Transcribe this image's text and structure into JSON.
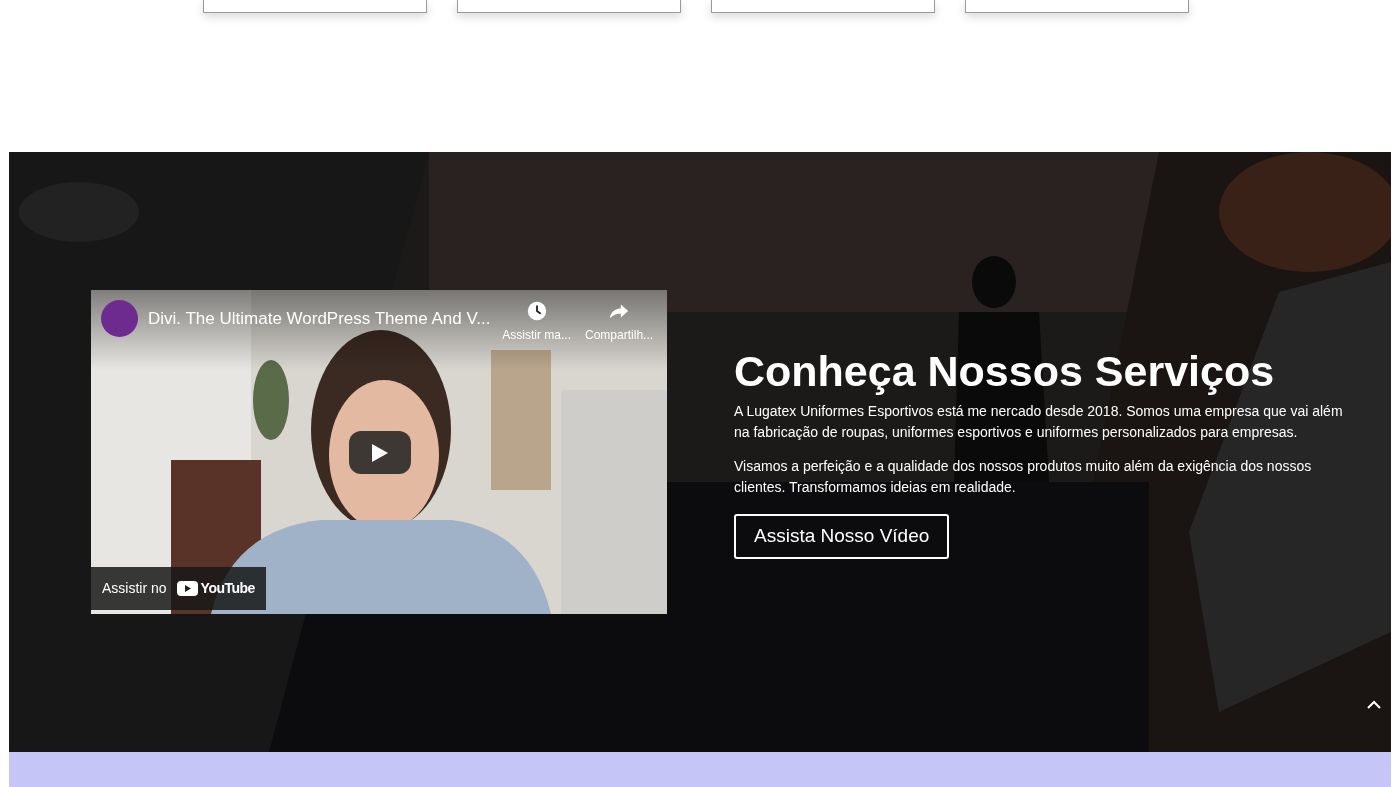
{
  "cards": [
    {
      "kind": "card"
    },
    {
      "kind": "card"
    },
    {
      "kind": "card"
    },
    {
      "kind": "card"
    }
  ],
  "services": {
    "video": {
      "title": "Divi. The Ultimate WordPress Theme And V...",
      "actions": [
        {
          "kind": "clock",
          "label": "Assistir ma..."
        },
        {
          "kind": "share",
          "label": "Compartilh..."
        }
      ],
      "watch_on": "Assistir no",
      "brand": "YouTube"
    },
    "heading": "Conheça Nossos Serviços",
    "paragraphs": [
      "A Lugatex Uniformes Esportivos está me nercado desde 2018. Somos uma empresa que vai além na fabricação de roupas, uniformes esportivos e uniformes personalizados para empresas.",
      "Visamos a perfeição e a qualidade dos nossos produtos muito além da exigência dos nossos clientes. Transformamos ideias em realidade."
    ],
    "button": "Assista Nosso Vídeo"
  }
}
